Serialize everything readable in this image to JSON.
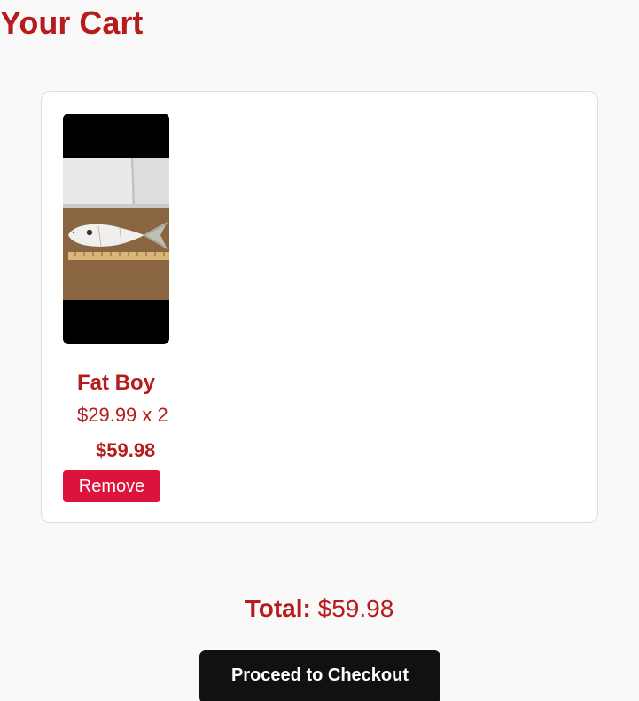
{
  "page": {
    "title": "Your Cart"
  },
  "cart": {
    "items": [
      {
        "name": "Fat Boy",
        "unit_price": "$29.99",
        "quantity": 2,
        "quantity_text": "$29.99 x 2",
        "subtotal": "$59.98",
        "remove_label": "Remove"
      }
    ]
  },
  "summary": {
    "total_label": "Total:",
    "total_value": "$59.98"
  },
  "actions": {
    "checkout_label": "Proceed to Checkout"
  },
  "colors": {
    "accent_text": "#b71c1c",
    "remove_button": "#dc143c",
    "checkout_button": "#111111",
    "page_background": "#f9f9f9",
    "card_background": "#ffffff"
  }
}
